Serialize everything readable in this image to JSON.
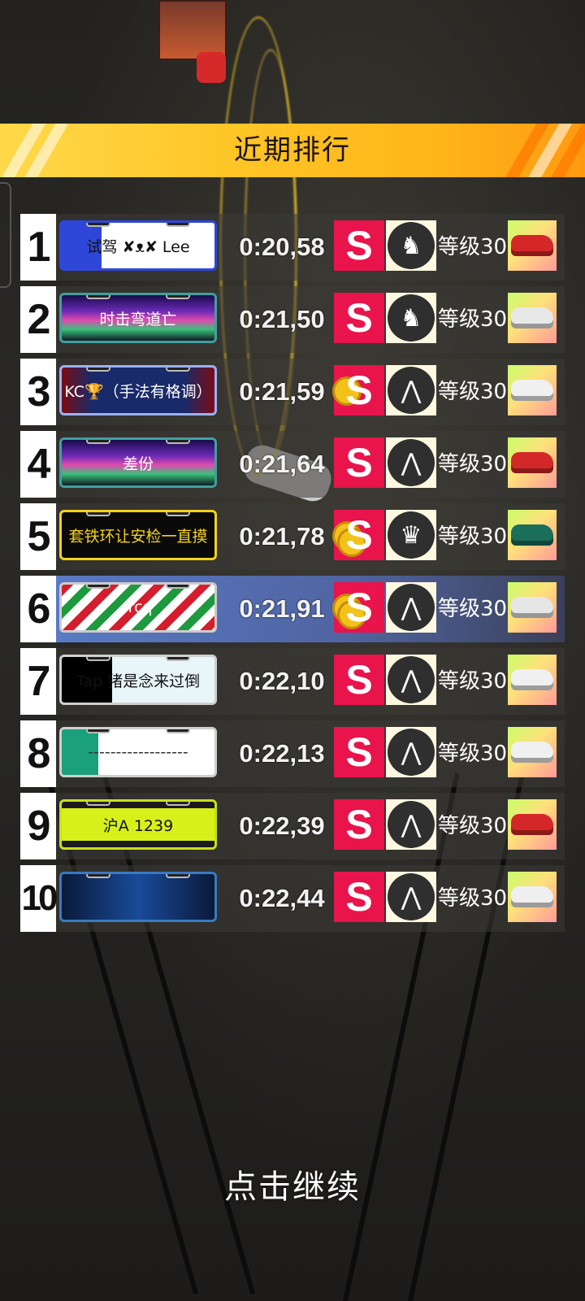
{
  "header": {
    "title": "近期排行"
  },
  "footer": {
    "continue_label": "点击继续"
  },
  "colors": {
    "header_gold": "#ffc526",
    "rank_s": "#e8144b",
    "highlight": "#6f8fe0"
  },
  "rows": [
    {
      "rank": "1",
      "plate": "试驾  ✘ᴥ✘ Lee",
      "plate_style": "blue-white",
      "time": "0:20,58",
      "s_rank": "S",
      "s_coins": 0,
      "emblem": "horse-emblem-icon",
      "emblem_glyph": "♞",
      "level": "等级30",
      "car_color": "#d42828"
    },
    {
      "rank": "2",
      "plate": "时击弯道亡",
      "plate_style": "aurora",
      "time": "0:21,50",
      "s_rank": "S",
      "s_coins": 0,
      "emblem": "horse-emblem-icon",
      "emblem_glyph": "♞",
      "level": "等级30",
      "car_color": "#e8e8e8"
    },
    {
      "rank": "3",
      "plate": "KC🏆（手法有格调）",
      "plate_style": "dark-red",
      "time": "0:21,59",
      "s_rank": "S",
      "s_coins": 1,
      "emblem": "road-emblem-icon",
      "emblem_glyph": "⋀",
      "level": "等级30",
      "car_color": "#f0f0f0"
    },
    {
      "rank": "4",
      "plate": "差份",
      "plate_style": "aurora",
      "time": "0:21,64",
      "s_rank": "S",
      "s_coins": 0,
      "emblem": "road-emblem-icon",
      "emblem_glyph": "⋀",
      "level": "等级30",
      "car_color": "#d42828"
    },
    {
      "rank": "5",
      "plate": "套铁环让安检一直摸",
      "plate_style": "black-gold",
      "time": "0:21,78",
      "s_rank": "S",
      "s_coins": 2,
      "emblem": "crown-emblem-icon",
      "emblem_glyph": "♛",
      "level": "等级30",
      "car_color": "#1a6e5a"
    },
    {
      "rank": "6",
      "plate": "lrcq",
      "plate_style": "christmas",
      "time": "0:21,91",
      "s_rank": "S",
      "s_coins": 2,
      "emblem": "road-emblem-icon",
      "emblem_glyph": "⋀",
      "level": "等级30",
      "car_color": "#e6e6e6",
      "highlight": true
    },
    {
      "rank": "7",
      "plate": "Tap 猪是念来过倒",
      "plate_style": "tap",
      "time": "0:22,10",
      "s_rank": "S",
      "s_coins": 0,
      "emblem": "road-emblem-icon",
      "emblem_glyph": "⋀",
      "level": "等级30",
      "car_color": "#f0f0f0"
    },
    {
      "rank": "8",
      "plate": "------------------",
      "plate_style": "green-white",
      "time": "0:22,13",
      "s_rank": "S",
      "s_coins": 0,
      "emblem": "road-emblem-icon",
      "emblem_glyph": "⋀",
      "level": "等级30",
      "car_color": "#f0f0f0"
    },
    {
      "rank": "9",
      "plate": "沪A 1239",
      "plate_style": "neon-yellow",
      "time": "0:22,39",
      "s_rank": "S",
      "s_coins": 0,
      "emblem": "road-emblem-icon",
      "emblem_glyph": "⋀",
      "level": "等级30",
      "car_color": "#d42828"
    },
    {
      "rank": "10",
      "plate": "",
      "plate_style": "cyber-blue",
      "time": "0:22,44",
      "s_rank": "S",
      "s_coins": 0,
      "emblem": "road-emblem-icon",
      "emblem_glyph": "⋀",
      "level": "等级30",
      "car_color": "#efefef"
    }
  ]
}
